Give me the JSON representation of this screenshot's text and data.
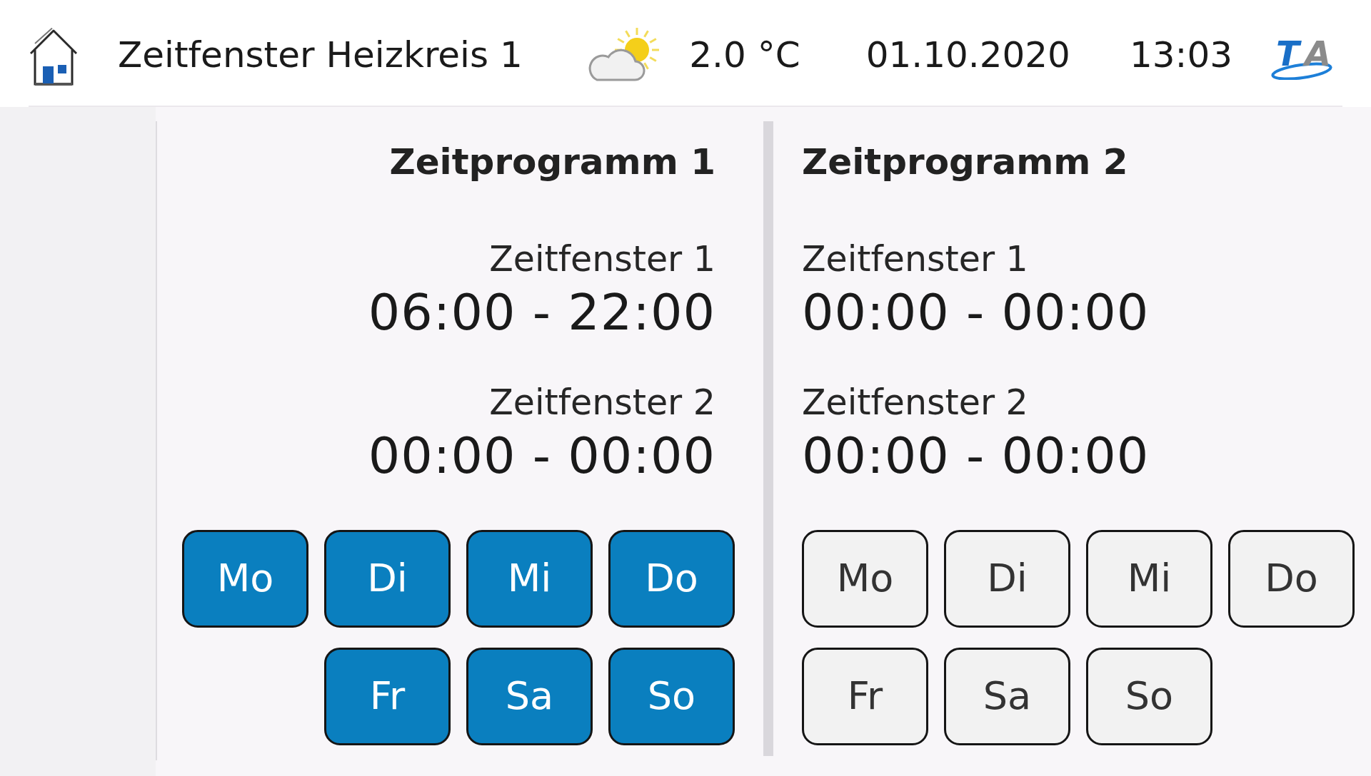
{
  "header": {
    "title": "Zeitfenster Heizkreis 1",
    "temperature": "2.0 °C",
    "date": "01.10.2020",
    "time": "13:03",
    "logo": {
      "letters": [
        "T",
        "A"
      ]
    }
  },
  "programs": [
    {
      "title": "Zeitprogramm 1",
      "windows": [
        {
          "label": "Zeitfenster 1",
          "range": "06:00 - 22:00"
        },
        {
          "label": "Zeitfenster 2",
          "range": "00:00 - 00:00"
        }
      ],
      "days": [
        {
          "label": "Mo",
          "selected": true
        },
        {
          "label": "Di",
          "selected": true
        },
        {
          "label": "Mi",
          "selected": true
        },
        {
          "label": "Do",
          "selected": true
        },
        {
          "label": "Fr",
          "selected": true
        },
        {
          "label": "Sa",
          "selected": true
        },
        {
          "label": "So",
          "selected": true
        }
      ]
    },
    {
      "title": "Zeitprogramm 2",
      "windows": [
        {
          "label": "Zeitfenster 1",
          "range": "00:00 - 00:00"
        },
        {
          "label": "Zeitfenster 2",
          "range": "00:00 - 00:00"
        }
      ],
      "days": [
        {
          "label": "Mo",
          "selected": false
        },
        {
          "label": "Di",
          "selected": false
        },
        {
          "label": "Mi",
          "selected": false
        },
        {
          "label": "Do",
          "selected": false
        },
        {
          "label": "Fr",
          "selected": false
        },
        {
          "label": "Sa",
          "selected": false
        },
        {
          "label": "So",
          "selected": false
        }
      ]
    }
  ]
}
